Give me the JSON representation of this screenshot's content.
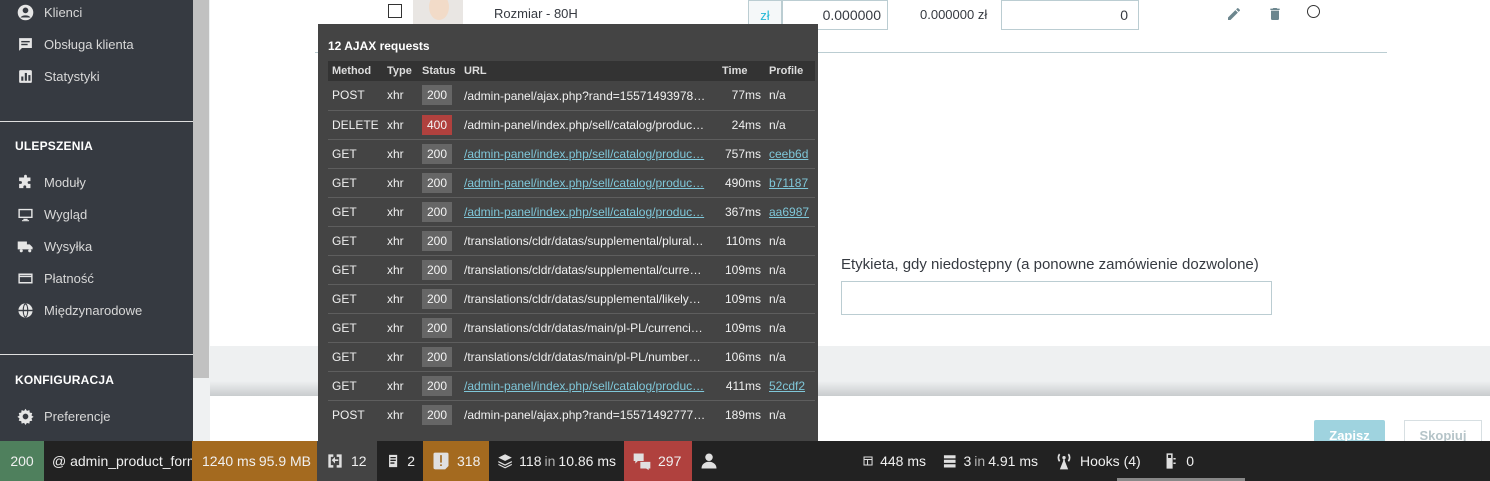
{
  "sidebar": {
    "items_top": [
      {
        "label": "Klienci",
        "icon": "person-circle-icon"
      },
      {
        "label": "Obsługa klienta",
        "icon": "chat-icon"
      },
      {
        "label": "Statystyki",
        "icon": "bar-chart-icon"
      }
    ],
    "section_improvements": "ULEPSZENIA",
    "items_improvements": [
      {
        "label": "Moduły",
        "icon": "puzzle-icon"
      },
      {
        "label": "Wygląd",
        "icon": "monitor-icon"
      },
      {
        "label": "Wysyłka",
        "icon": "truck-icon"
      },
      {
        "label": "Płatność",
        "icon": "credit-card-icon"
      },
      {
        "label": "Międzynarodowe",
        "icon": "globe-icon"
      }
    ],
    "section_config": "KONFIGURACJA",
    "items_config": [
      {
        "label": "Preferencje",
        "icon": "gear-icon"
      }
    ]
  },
  "combination_row": {
    "label": "Rozmiar - 80H",
    "currency": "zł",
    "impact_price": "0.000000",
    "final_price": "0.000000 zł",
    "quantity": "0"
  },
  "form": {
    "unavailable_label": "Etykieta, gdy niedostępny (a ponowne zamówienie dozwolone)",
    "save_button": "Zapisz",
    "copy_button": "Skopiuj"
  },
  "ajax_panel": {
    "title": "12 AJAX requests",
    "columns": [
      "Method",
      "Type",
      "Status",
      "URL",
      "Time",
      "Profile"
    ],
    "rows": [
      {
        "method": "POST",
        "type": "xhr",
        "status": "200",
        "url": "/admin-panel/ajax.php?rand=15571493978…",
        "time": "77ms",
        "profile": "n/a"
      },
      {
        "method": "DELETE",
        "type": "xhr",
        "status": "400",
        "url": "/admin-panel/index.php/sell/catalog/produc…",
        "time": "24ms",
        "profile": "n/a"
      },
      {
        "method": "GET",
        "type": "xhr",
        "status": "200",
        "url": "/admin-panel/index.php/sell/catalog/produc…",
        "time": "757ms",
        "profile": "ceeb6d"
      },
      {
        "method": "GET",
        "type": "xhr",
        "status": "200",
        "url": "/admin-panel/index.php/sell/catalog/produc…",
        "time": "490ms",
        "profile": "b71187"
      },
      {
        "method": "GET",
        "type": "xhr",
        "status": "200",
        "url": "/admin-panel/index.php/sell/catalog/produc…",
        "time": "367ms",
        "profile": "aa6987"
      },
      {
        "method": "GET",
        "type": "xhr",
        "status": "200",
        "url": "/translations/cldr/datas/supplemental/plural…",
        "time": "110ms",
        "profile": "n/a"
      },
      {
        "method": "GET",
        "type": "xhr",
        "status": "200",
        "url": "/translations/cldr/datas/supplemental/curre…",
        "time": "109ms",
        "profile": "n/a"
      },
      {
        "method": "GET",
        "type": "xhr",
        "status": "200",
        "url": "/translations/cldr/datas/supplemental/likely…",
        "time": "109ms",
        "profile": "n/a"
      },
      {
        "method": "GET",
        "type": "xhr",
        "status": "200",
        "url": "/translations/cldr/datas/main/pl-PL/currenci…",
        "time": "109ms",
        "profile": "n/a"
      },
      {
        "method": "GET",
        "type": "xhr",
        "status": "200",
        "url": "/translations/cldr/datas/main/pl-PL/number…",
        "time": "106ms",
        "profile": "n/a"
      },
      {
        "method": "GET",
        "type": "xhr",
        "status": "200",
        "url": "/admin-panel/index.php/sell/catalog/produc…",
        "time": "411ms",
        "profile": "52cdf2"
      },
      {
        "method": "POST",
        "type": "xhr",
        "status": "200",
        "url": "/admin-panel/ajax.php?rand=15571492777…",
        "time": "189ms",
        "profile": "n/a"
      }
    ]
  },
  "toolbar": {
    "status_code": "200",
    "route": "@ admin_product_form",
    "time": "1240 ms",
    "memory": "95.9 MB",
    "ajax_count": "12",
    "logs_count": "2",
    "deprecations_count": "318",
    "cache_count": "118",
    "cache_in": "in",
    "cache_time": "10.86 ms",
    "translation_count": "297",
    "twig_time": "448 ms",
    "db_queries": "3",
    "db_in": "in",
    "db_time": "4.91 ms",
    "hooks_label": "Hooks (4)",
    "modules_count": "0"
  },
  "colors": {
    "sidebar_bg": "#363a41",
    "status_ok": "#4f805d",
    "status_error": "#b0413e",
    "warning_bg": "#a46a1f",
    "link": "#7fc7d9"
  }
}
